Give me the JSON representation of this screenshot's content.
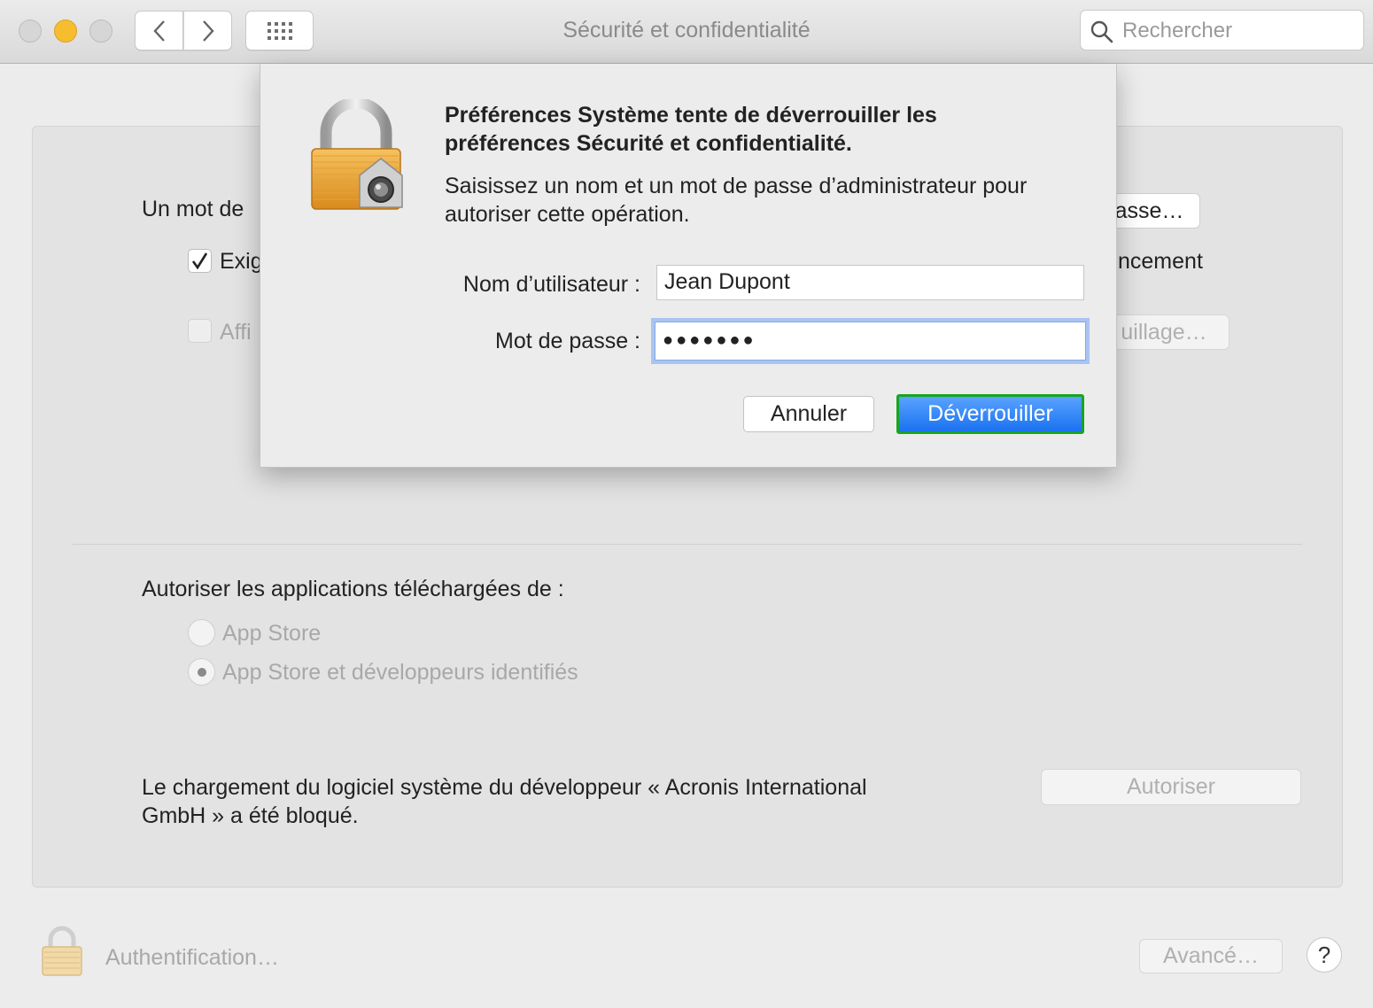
{
  "window": {
    "title": "Sécurité et confidentialité",
    "search_placeholder": "Rechercher"
  },
  "panel": {
    "password_row_label": "Un mot de",
    "change_password_button": "asse…",
    "require_checkbox_label": "Exig",
    "require_checkbox_checked": true,
    "require_suffix": "ncement",
    "show_message_checkbox_label": "Affi",
    "show_message_checkbox_checked": false,
    "lock_message_button": "uillage…",
    "allow_apps_heading": "Autoriser les applications téléchargées de :",
    "radio_options": [
      {
        "label": "App Store",
        "selected": false
      },
      {
        "label": "App Store et développeurs identifiés",
        "selected": true
      }
    ],
    "blocked_message_line1": "Le chargement du logiciel système du développeur « Acronis International",
    "blocked_message_line2": "GmbH » a été bloqué.",
    "allow_button": "Autoriser"
  },
  "dialog": {
    "title_line1": "Préférences Système tente de déverrouiller les",
    "title_line2": "préférences Sécurité et confidentialité.",
    "subtitle_line1": "Saisissez un nom et un mot de passe d’administrateur pour",
    "subtitle_line2": "autoriser cette opération.",
    "username_label": "Nom d’utilisateur :",
    "username_value": "Jean Dupont",
    "password_label": "Mot de passe :",
    "password_masked": "●●●●●●●",
    "cancel_button": "Annuler",
    "unlock_button": "Déverrouiller"
  },
  "footer": {
    "auth_label": "Authentification…",
    "advanced_button": "Avancé…",
    "help_button": "?"
  },
  "colors": {
    "accent_blue": "#1a72f0",
    "focus_outline_green": "#17a520",
    "minimize_yellow": "#f6bd2f"
  },
  "icons": [
    "search-icon",
    "chevron-left-icon",
    "chevron-right-icon",
    "grid-icon",
    "padlock-icon",
    "checkmark-icon",
    "help-icon"
  ]
}
